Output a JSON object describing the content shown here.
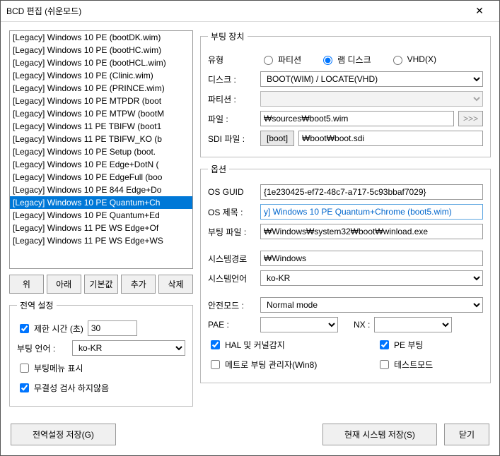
{
  "window": {
    "title": "BCD 편집 (쉬운모드)"
  },
  "list": [
    "[Legacy] Windows 10 PE (bootDK.wim)",
    "[Legacy] Windows 10 PE (bootHC.wim)",
    "[Legacy] Windows 10 PE (bootHCL.wim)",
    "[Legacy] Windows 10 PE (Clinic.wim)",
    "[Legacy] Windows 10 PE (PRINCE.wim)",
    "[Legacy] Windows 10 PE MTPDR (boot",
    "[Legacy] Windows 10 PE MTPW (bootM",
    "[Legacy] Windows 11 PE TBIFW (boot1",
    "[Legacy] Windows 11 PE TBIFW_KO (b",
    "[Legacy] Windows 10 PE Setup (boot.",
    "[Legacy] Windows 10 PE Edge+DotN (",
    "[Legacy] Windows 10 PE EdgeFull (boo",
    "[Legacy] Windows 10 PE 844 Edge+Do",
    "[Legacy] Windows 10 PE Quantum+Ch",
    "[Legacy] Windows 10 PE Quantum+Ed",
    "[Legacy] Windows 11 PE WS Edge+Of",
    "[Legacy] Windows 11 PE WS Edge+WS"
  ],
  "list_selected": 13,
  "buttons": {
    "up": "위",
    "down": "아래",
    "default": "기본값",
    "add": "추가",
    "delete": "삭제"
  },
  "global": {
    "legend": "전역 설정",
    "timeout_label": "제한 시간 (초)",
    "timeout_value": "30",
    "bootlang_label": "부팅 언어 :",
    "bootlang_value": "ko-KR",
    "bootmenu_label": "부팅메뉴 표시",
    "integrity_label": "무결성 검사 하지않음"
  },
  "bootdev": {
    "legend": "부팅 장치",
    "type_label": "유형",
    "radio_partition": "파티션",
    "radio_ramdisk": "램 디스크",
    "radio_vhd": "VHD(X)",
    "disk_label": "디스크 :",
    "disk_value": "BOOT(WIM) / LOCATE(VHD)",
    "partition_label": "파티션 :",
    "file_label": "파일 :",
    "file_value": "₩sources₩boot5.wim",
    "file_btn": ">>>",
    "sdi_label": "SDI 파일 :",
    "sdi_btn": "[boot]",
    "sdi_value": "₩boot₩boot.sdi"
  },
  "options": {
    "legend": "옵션",
    "guid_label": "OS GUID",
    "guid_value": "{1e230425-ef72-48c7-a717-5c93bbaf7029}",
    "title_label": "OS 제목 :",
    "title_value": "y] Windows 10 PE Quantum+Chrome (boot5.wim)",
    "bootfile_label": "부팅 파일 :",
    "bootfile_value": "₩Windows₩system32₩boot₩winload.exe",
    "syspath_label": "시스템경로",
    "syspath_value": "₩Windows",
    "syslang_label": "시스템언어",
    "syslang_value": "ko-KR",
    "safemode_label": "안전모드 :",
    "safemode_value": "Normal mode",
    "pae_label": "PAE :",
    "nx_label": "NX :",
    "hal_label": "HAL 및 커널감지",
    "pe_label": "PE 부팅",
    "metro_label": "메트로 부팅 관리자(Win8)",
    "test_label": "테스트모드"
  },
  "footer": {
    "save_global": "전역설정 저장(G)",
    "save_current": "현재 시스템 저장(S)",
    "close": "닫기"
  }
}
